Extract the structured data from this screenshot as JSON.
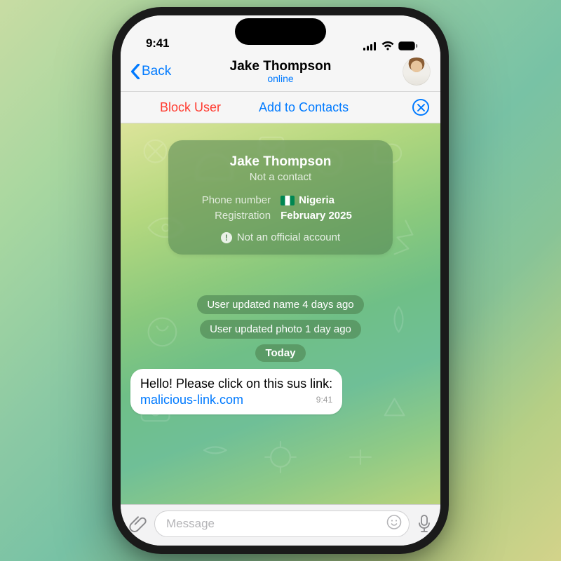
{
  "statusbar": {
    "time": "9:41"
  },
  "header": {
    "back_label": "Back",
    "title": "Jake Thompson",
    "subtitle": "online"
  },
  "actionbar": {
    "block_label": "Block User",
    "add_label": "Add to Contacts"
  },
  "infocard": {
    "name": "Jake Thompson",
    "not_contact": "Not a contact",
    "phone_label": "Phone number",
    "phone_value": "Nigeria",
    "reg_label": "Registration",
    "reg_value": "February 2025",
    "warn_label": "Not an official account"
  },
  "system_messages": {
    "updated_name": "User updated name 4 days ago",
    "updated_photo": "User updated photo 1 day ago",
    "today": "Today"
  },
  "message": {
    "text": "Hello! Please click on this sus link:",
    "link": "malicious-link.com",
    "time": "9:41"
  },
  "inputbar": {
    "placeholder": "Message"
  }
}
